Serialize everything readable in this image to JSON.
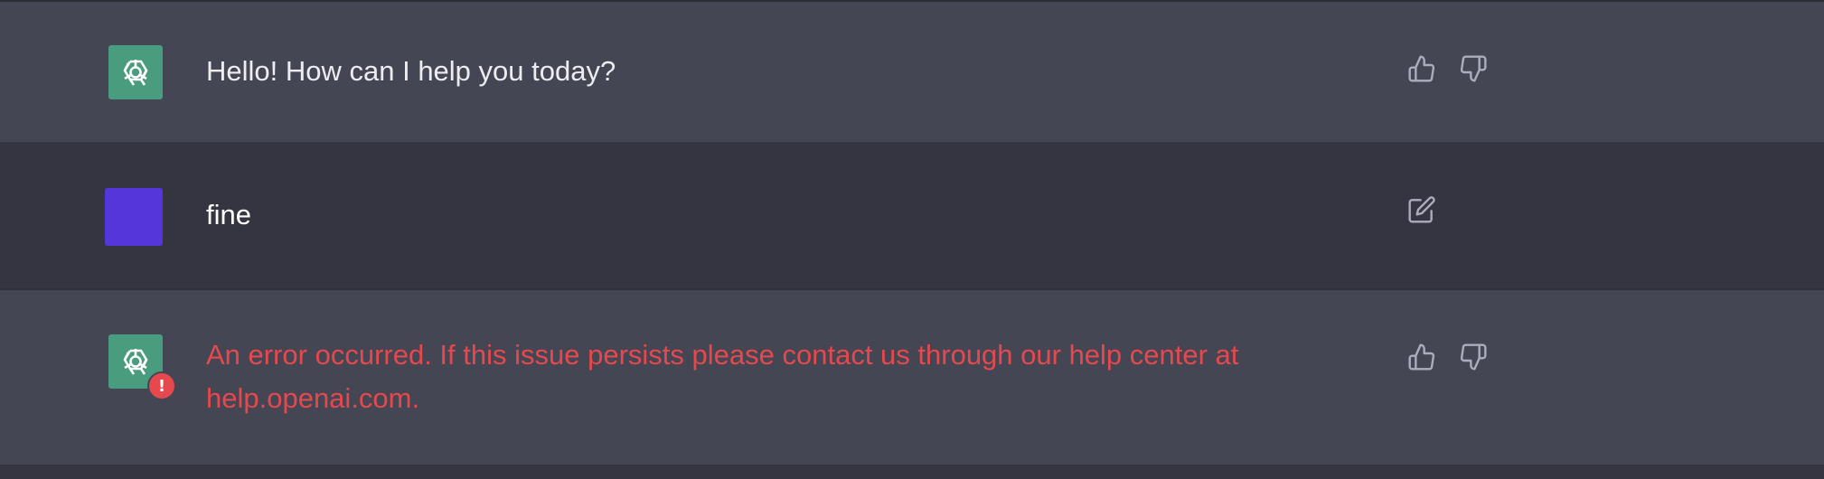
{
  "messages": [
    {
      "role": "assistant",
      "text": "Hello! How can I help you today?",
      "actions": [
        "thumbs-up",
        "thumbs-down"
      ]
    },
    {
      "role": "user",
      "text": "fine",
      "actions": [
        "edit"
      ]
    },
    {
      "role": "assistant",
      "status": "error",
      "text": "An error occurred. If this issue persists please contact us through our help center at help.openai.com.",
      "actions": [
        "thumbs-up",
        "thumbs-down"
      ],
      "badge": "!"
    }
  ],
  "colors": {
    "assistant_bg": "#444654",
    "user_bg": "#343541",
    "assistant_avatar": "#4a9c7f",
    "user_avatar": "#5436da",
    "error_text": "#e5484d",
    "message_text": "#ececf1",
    "icon": "#acacbe"
  }
}
